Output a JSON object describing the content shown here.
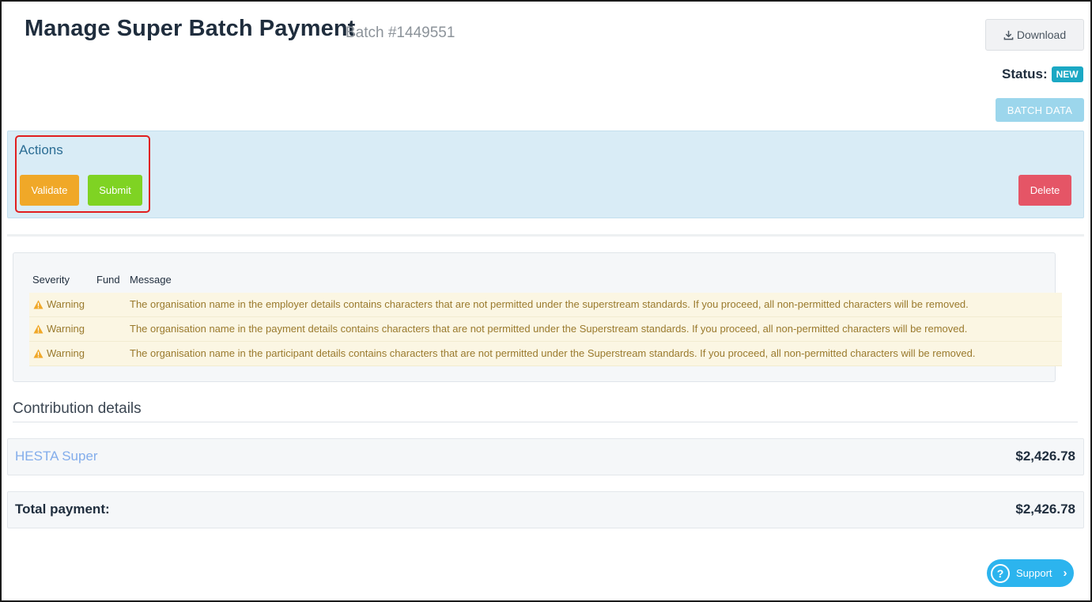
{
  "header": {
    "title": "Manage Super Batch Payment",
    "batch_label": "Batch #1449551",
    "download_label": "Download",
    "status_label": "Status:",
    "status_value": "NEW",
    "batch_data_label": "BATCH DATA"
  },
  "actions": {
    "title": "Actions",
    "validate_label": "Validate",
    "submit_label": "Submit",
    "delete_label": "Delete"
  },
  "messages": {
    "columns": [
      "Severity",
      "Fund",
      "Message"
    ],
    "rows": [
      {
        "severity": "Warning",
        "fund": "",
        "message": "The organisation name in the employer details contains characters that are not permitted under the superstream standards. If you proceed, all non-permitted characters will be removed."
      },
      {
        "severity": "Warning",
        "fund": "",
        "message": "The organisation name in the payment details contains characters that are not permitted under the Superstream standards. If you proceed, all non-permitted characters will be removed."
      },
      {
        "severity": "Warning",
        "fund": "",
        "message": "The organisation name in the participant details contains characters that are not permitted under the Superstream standards. If you proceed, all non-permitted characters will be removed."
      }
    ]
  },
  "contribution": {
    "title": "Contribution details",
    "fund_name": "HESTA Super",
    "fund_amount": "$2,426.78",
    "total_label": "Total payment:",
    "total_amount": "$2,426.78"
  },
  "support": {
    "label": "Support"
  },
  "colors": {
    "validate": "#f0a828",
    "submit": "#7fd323",
    "delete": "#e55566",
    "status_badge": "#1ba8c4",
    "actions_panel": "#d9ecf6",
    "warning_text": "#9a7a2d",
    "highlight_border": "#e11f1f"
  }
}
